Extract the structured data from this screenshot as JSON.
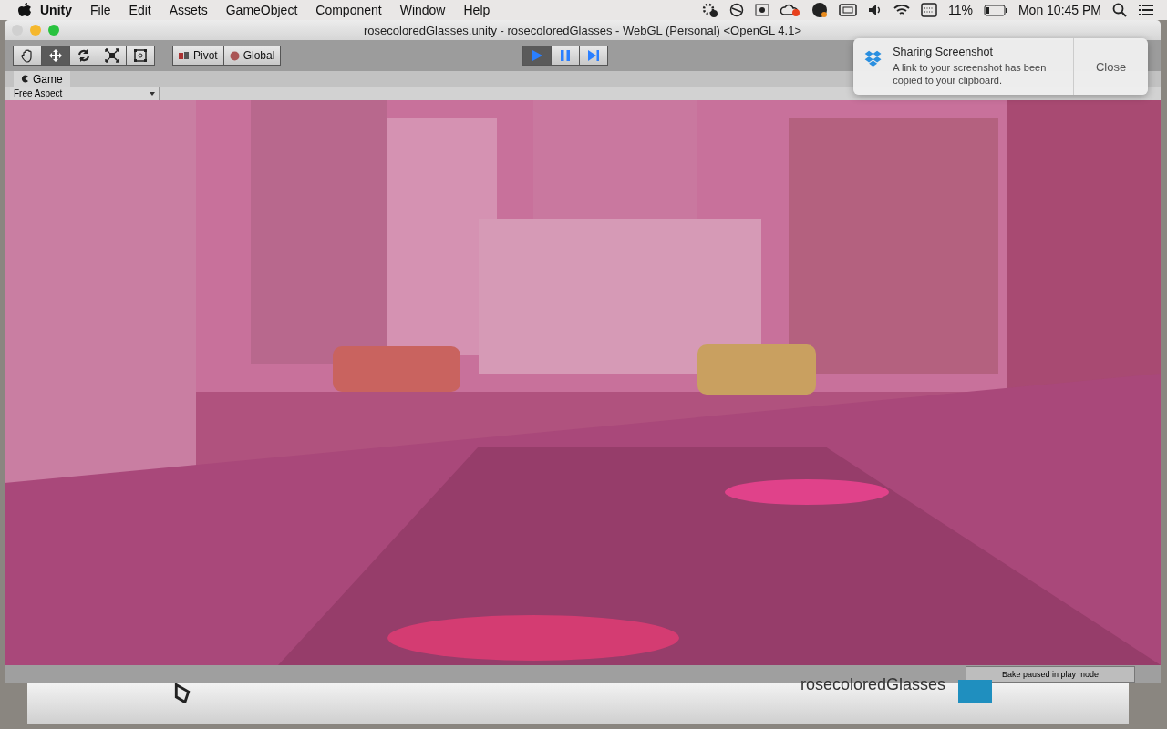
{
  "menu_bar": {
    "app_name": "Unity",
    "items": [
      "File",
      "Edit",
      "Assets",
      "GameObject",
      "Component",
      "Window",
      "Help"
    ],
    "battery": "11%",
    "clock": "Mon 10:45 PM"
  },
  "window": {
    "title": "rosecoloredGlasses.unity - rosecoloredGlasses - WebGL (Personal) <OpenGL 4.1>"
  },
  "toolbar": {
    "tools": [
      {
        "kind": "hand",
        "selected": false
      },
      {
        "kind": "move",
        "selected": true
      },
      {
        "kind": "rotate",
        "selected": false
      },
      {
        "kind": "scale",
        "selected": false
      },
      {
        "kind": "rect",
        "selected": false
      }
    ],
    "pivot": "Pivot",
    "global": "Global",
    "playback": [
      {
        "kind": "play",
        "selected": true
      },
      {
        "kind": "pause",
        "selected": false
      },
      {
        "kind": "step",
        "selected": false
      }
    ]
  },
  "game_panel": {
    "tab": "Game",
    "aspect": "Free Aspect"
  },
  "status_bar": {
    "text": "Bake paused in play mode"
  },
  "background_page": {
    "title": "rosecoloredGlasses"
  },
  "notification": {
    "title": "Sharing Screenshot",
    "body": "A link to your screenshot has been copied to your clipboard.",
    "button": "Close"
  }
}
